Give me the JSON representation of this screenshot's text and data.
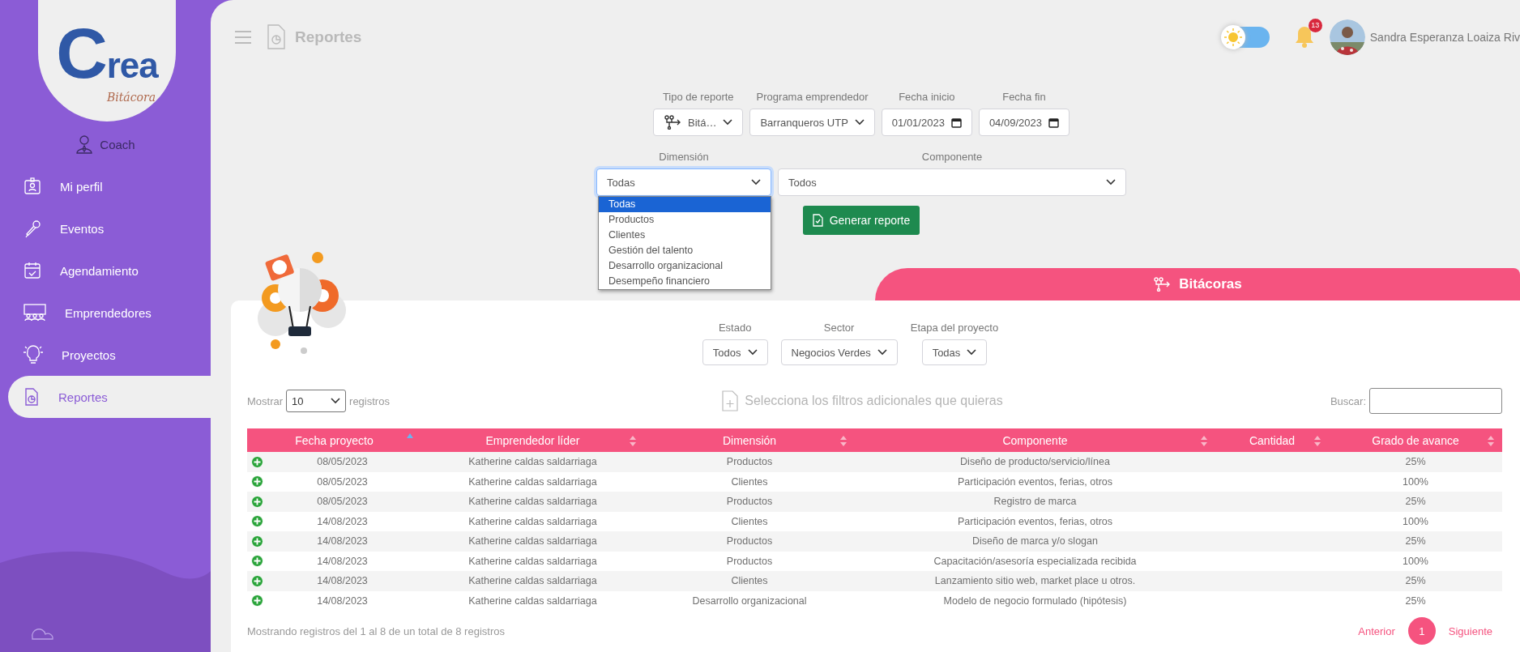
{
  "sidebar": {
    "logo": "Crea",
    "logo_sub": "Bitácora",
    "role": "Coach",
    "items": [
      {
        "label": "Mi perfil",
        "selected": false
      },
      {
        "label": "Eventos",
        "selected": false
      },
      {
        "label": "Agendamiento",
        "selected": false
      },
      {
        "label": "Emprendedores",
        "selected": false
      },
      {
        "label": "Proyectos",
        "selected": false
      },
      {
        "label": "Reportes",
        "selected": true
      }
    ]
  },
  "header": {
    "title": "Reportes",
    "dark_mode": false,
    "notifications": "13",
    "user": "Sandra Esperanza Loaiza Riv"
  },
  "top_filters": [
    {
      "kind": "select",
      "label": "Tipo de reporte",
      "value": "Bitá…"
    },
    {
      "kind": "select",
      "label": "Programa emprendedor",
      "value": "Barranqueros UTP"
    },
    {
      "kind": "date",
      "label": "Fecha inicio",
      "value": "01/01/2023"
    },
    {
      "kind": "date",
      "label": "Fecha fin",
      "value": "04/09/2023"
    }
  ],
  "dimension": {
    "label": "Dimensión",
    "value": "Todas",
    "expanded": true,
    "options": [
      {
        "label": "Todas",
        "selected": true
      },
      {
        "label": "Productos",
        "selected": false
      },
      {
        "label": "Clientes",
        "selected": false
      },
      {
        "label": "Gestión del talento",
        "selected": false
      },
      {
        "label": "Desarrollo organizacional",
        "selected": false
      },
      {
        "label": "Desempeño financiero",
        "selected": false
      }
    ]
  },
  "component": {
    "label": "Componente",
    "value": "Todos"
  },
  "generate_button": "Generar reporte",
  "section_tab": "Bitácoras",
  "card_filters": [
    {
      "label": "Estado",
      "value": "Todos"
    },
    {
      "label": "Sector",
      "value": "Negocios Verdes"
    },
    {
      "label": "Etapa del proyecto",
      "value": "Todas"
    }
  ],
  "hint": "Selecciona los filtros adicionales que quieras",
  "page_length": {
    "prefix": "Mostrar",
    "value": "10",
    "suffix": "registros"
  },
  "search": {
    "label": "Buscar:"
  },
  "table": {
    "columns": [
      {
        "label": "Fecha proyecto",
        "sorted": true
      },
      {
        "label": "Emprendedor líder",
        "sorted": false
      },
      {
        "label": "Dimensión",
        "sorted": false
      },
      {
        "label": "Componente",
        "sorted": false
      },
      {
        "label": "Cantidad",
        "sorted": false
      },
      {
        "label": "Grado de avance",
        "sorted": false
      }
    ],
    "rows": [
      {
        "date": "08/05/2023",
        "leader": "Katherine caldas saldarriaga",
        "dimension": "Productos",
        "component": "Diseño de producto/servicio/línea",
        "progress": "25%"
      },
      {
        "date": "08/05/2023",
        "leader": "Katherine caldas saldarriaga",
        "dimension": "Clientes",
        "component": "Participación eventos, ferias, otros",
        "progress": "100%"
      },
      {
        "date": "08/05/2023",
        "leader": "Katherine caldas saldarriaga",
        "dimension": "Productos",
        "component": "Registro de marca",
        "progress": "25%"
      },
      {
        "date": "14/08/2023",
        "leader": "Katherine caldas saldarriaga",
        "dimension": "Clientes",
        "component": "Participación eventos, ferias, otros",
        "progress": "100%"
      },
      {
        "date": "14/08/2023",
        "leader": "Katherine caldas saldarriaga",
        "dimension": "Productos",
        "component": "Diseño de marca y/o slogan",
        "progress": "25%"
      },
      {
        "date": "14/08/2023",
        "leader": "Katherine caldas saldarriaga",
        "dimension": "Productos",
        "component": "Capacitación/asesoría especializada recibida",
        "progress": "100%"
      },
      {
        "date": "14/08/2023",
        "leader": "Katherine caldas saldarriaga",
        "dimension": "Clientes",
        "component": "Lanzamiento sitio web, market place u otros.",
        "progress": "25%"
      },
      {
        "date": "14/08/2023",
        "leader": "Katherine caldas saldarriaga",
        "dimension": "Desarrollo organizacional",
        "component": "Modelo de negocio formulado (hipótesis)",
        "progress": "25%"
      }
    ]
  },
  "info": "Mostrando registros del 1 al 8 de un total de 8 registros",
  "pagination": {
    "previous": "Anterior",
    "pages": [
      {
        "label": "1",
        "selected": true
      }
    ],
    "next": "Siguiente"
  }
}
